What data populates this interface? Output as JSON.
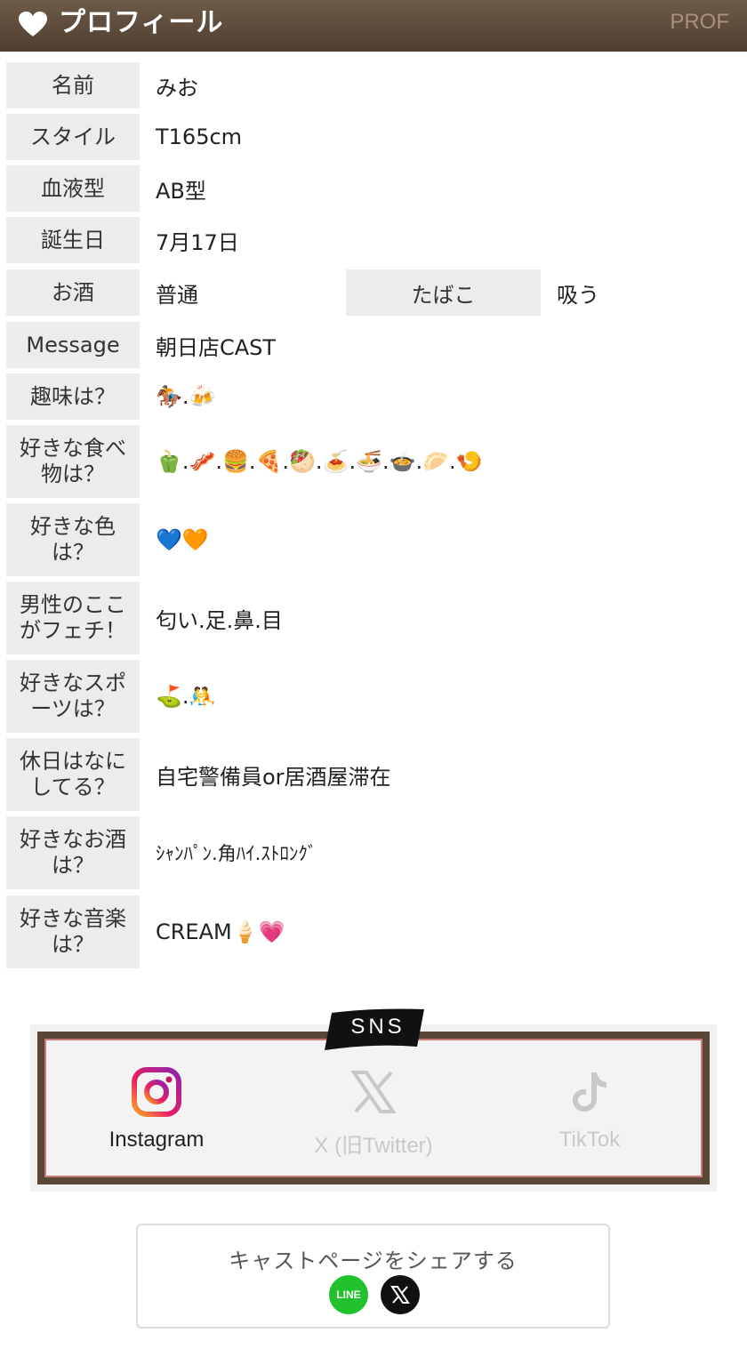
{
  "header": {
    "title": "プロフィール",
    "tag": "PROF",
    "icon": "heart-icon"
  },
  "profile": {
    "rows": [
      {
        "label": "名前",
        "value": "みお"
      },
      {
        "label": "スタイル",
        "value": "T165cm"
      },
      {
        "label": "血液型",
        "value": "AB型"
      },
      {
        "label": "誕生日",
        "value": "7月17日"
      },
      {
        "label": "お酒",
        "value": "普通",
        "label2": "たばこ",
        "value2": "吸う"
      },
      {
        "label": "Message",
        "value": "朝日店CAST"
      },
      {
        "label": "趣味は？",
        "value": "🏇.🍻"
      },
      {
        "label": "好きな食べ物は？",
        "value": "🫑.🥓.🍔.🍕.🥙.🍝.🍜.🍲.🥟.🍤"
      },
      {
        "label": "好きな色は？",
        "value": "💙🧡"
      },
      {
        "label": "男性のここがフェチ！",
        "value": "匂い.足.鼻.目"
      },
      {
        "label": "好きなスポーツは？",
        "value": "⛳.🤼"
      },
      {
        "label": "休日はなにしてる？",
        "value": "自宅警備員or居酒屋滞在"
      },
      {
        "label": "好きなお酒は？",
        "value": "ｼｬﾝﾊﾟﾝ.角ﾊｲ.ｽﾄﾛﾝｸﾞ"
      },
      {
        "label": "好きな音楽は？",
        "value": "CREAM🍦💗"
      }
    ]
  },
  "sns": {
    "badge": "SNS",
    "items": [
      {
        "label": "Instagram",
        "icon": "instagram-icon",
        "active": true
      },
      {
        "label": "X (旧Twitter)",
        "icon": "x-icon",
        "active": false
      },
      {
        "label": "TikTok",
        "icon": "tiktok-icon",
        "active": false
      }
    ]
  },
  "share": {
    "text": "キャストページをシェアする",
    "line_label": "LINE",
    "x_icon": "x-icon"
  },
  "colors": {
    "header_bg": "#5c4a3a",
    "label_bg": "#ececec",
    "frame": "#5a4637",
    "inactive": "#c4c4c4"
  }
}
